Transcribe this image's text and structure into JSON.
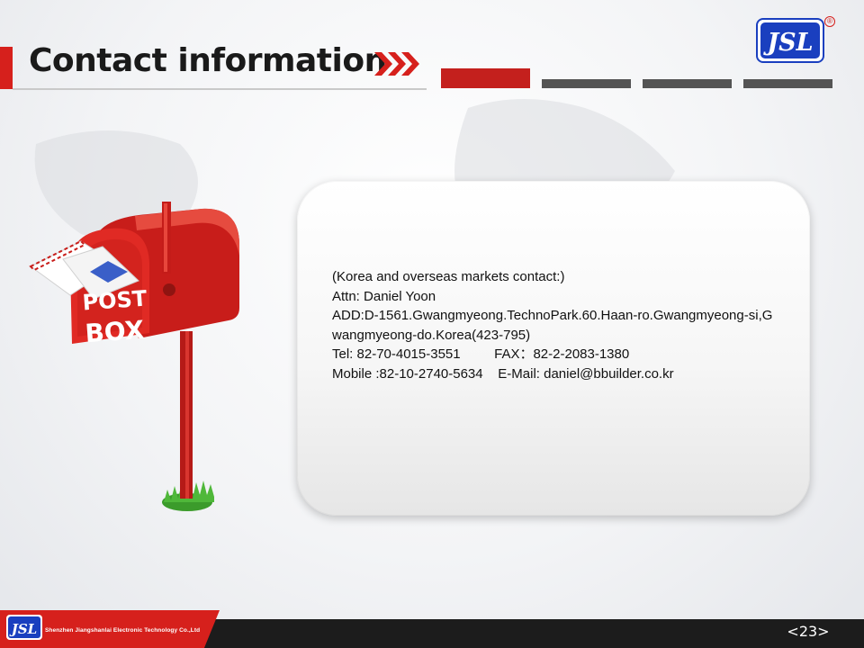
{
  "header": {
    "title": "Contact information",
    "chevron_icon": "triple-chevron-right-icon"
  },
  "brand": {
    "logo_text": "JSL",
    "registered_mark": "®",
    "company_name": "Shenzhen Jiangshanlai Electronic Technology Co.,Ltd",
    "colors": {
      "accent_red": "#d6201c",
      "logo_blue": "#1a3fbf",
      "tab_gray": "#545454"
    }
  },
  "illustration": {
    "icon": "mailbox-icon",
    "label_line1": "POST",
    "label_line2": "BOX"
  },
  "contact": {
    "line1": "(Korea and overseas markets contact:)",
    "line2": "Attn: Daniel Yoon",
    "line3": "ADD:D-1561.Gwangmyeong.TechnoPark.60.Haan-ro.Gwangmyeong-si,Gwangmyeong-do.Korea(423-795)",
    "line4": "Tel: 82-70-4015-3551         FAX：82-2-2083-1380",
    "line5": "Mobile :82-10-2740-5634    E-Mail: daniel@bbuilder.co.kr"
  },
  "footer": {
    "page_number": "<23>"
  }
}
